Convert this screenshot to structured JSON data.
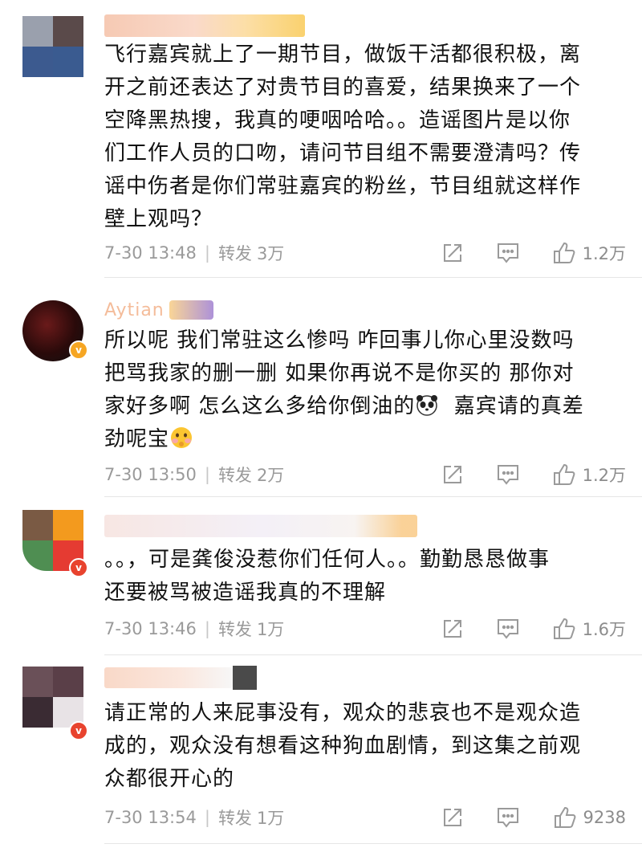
{
  "colors": {
    "meta_text": "#9a9a9a",
    "divider": "#e6e6e6",
    "badge_orange": "#f6a623",
    "badge_red": "#e8432e"
  },
  "comments": [
    {
      "text_lines": [
        "飞行嘉宾就上了一期节目，做饭干活都很积极，离",
        "开之前还表达了对贵节目的喜爱，结果换来了一个",
        "空降黑热搜，我真的哽咽哈哈。。造谣图片是以你",
        "们工作人员的口吻，请问节目组不需要澄清吗？传",
        "谣中伤者是你们常驻嘉宾的粉丝，节目组就这样作",
        "壁上观吗？"
      ],
      "time": "7-30 13:48",
      "repost_label": "转发",
      "repost_count": "3万",
      "likes": "1.2万"
    },
    {
      "username_partial": "Aytian",
      "text_lines": [
        "所以呢 我们常驻这么惨吗  咋回事儿你心里没数吗",
        "把骂我家的删一删  如果你再说不是你买的  那你对",
        "家好多啊  怎么这么多给你倒油的",
        "劲呢宝"
      ],
      "line3_suffix": "  嘉宾请的真差",
      "time": "7-30 13:50",
      "repost_label": "转发",
      "repost_count": "2万",
      "likes": "1.2万"
    },
    {
      "text_lines": [
        "。。，可是龚俊没惹你们任何人。。勤勤恳恳做事",
        "还要被骂被造谣我真的不理解"
      ],
      "time": "7-30 13:46",
      "repost_label": "转发",
      "repost_count": "1万",
      "likes": "1.6万"
    },
    {
      "text_lines": [
        "请正常的人来屁事没有，观众的悲哀也不是观众造",
        "成的，观众没有想看这种狗血剧情，到这集之前观",
        "众都很开心的"
      ],
      "time": "7-30 13:54",
      "repost_label": "转发",
      "repost_count": "1万",
      "likes": "9238"
    }
  ],
  "icons": {
    "share": "share-icon",
    "comment": "comment-icon",
    "like": "like-icon",
    "panda": "panda-emoji-icon",
    "hug": "hug-emoji-icon"
  }
}
